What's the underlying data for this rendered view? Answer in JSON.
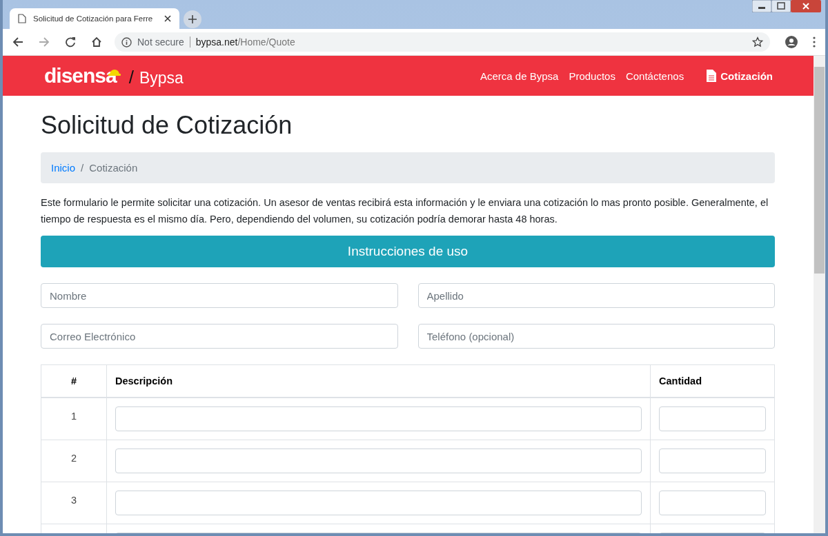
{
  "browser": {
    "tab_title": "Solicitud de Cotización para Ferre",
    "security": "Not secure",
    "url_host": "bypsa.net",
    "url_path": "/Home/Quote"
  },
  "header": {
    "logo": "disensa",
    "separator": "/",
    "brand": "Bypsa",
    "nav": [
      {
        "label": "Acerca de Bypsa",
        "selected": false
      },
      {
        "label": "Productos",
        "selected": false
      },
      {
        "label": "Contáctenos",
        "selected": false
      },
      {
        "label": "Cotización",
        "selected": true
      }
    ]
  },
  "page_title": "Solicitud de Cotización",
  "breadcrumb": [
    {
      "label": "Inicio",
      "kind": "link"
    },
    {
      "label": "/",
      "kind": "separator"
    },
    {
      "label": "Cotización",
      "kind": "current"
    }
  ],
  "intro": "Este formulario le permite solicitar una cotización. Un asesor de ventas recibirá esta información y le enviara una cotización lo mas pronto posible. Generalmente, el tiempo de respuesta es el mismo día. Pero, dependiendo del volumen, su cotización podría demorar hasta 48 horas.",
  "instructions_button": "Instrucciones de uso",
  "fields": [
    {
      "placeholder": "Nombre"
    },
    {
      "placeholder": "Apellido"
    },
    {
      "placeholder": "Correo Electrónico"
    },
    {
      "placeholder": "Teléfono (opcional)"
    }
  ],
  "table": {
    "columns": [
      "#",
      "Descripción",
      "Cantidad"
    ],
    "rows": [
      {
        "number": "1"
      },
      {
        "number": "2"
      },
      {
        "number": "3"
      }
    ]
  }
}
